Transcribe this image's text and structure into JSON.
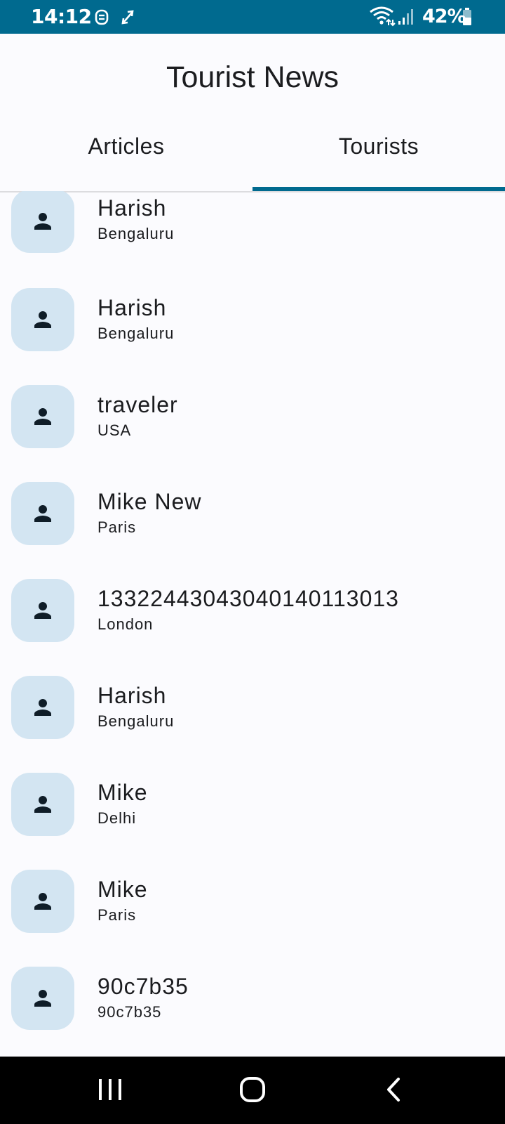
{
  "status_bar": {
    "time": "14:12",
    "battery": "42%",
    "icons": [
      "app-notification-icon",
      "sync-icon",
      "wifi-icon",
      "signal-icon",
      "battery-icon"
    ],
    "background_color": "#006a8f"
  },
  "app": {
    "title": "Tourist News"
  },
  "tabs": [
    {
      "label": "Articles",
      "selected": false
    },
    {
      "label": "Tourists",
      "selected": true
    }
  ],
  "accent_color": "#006a8f",
  "tourists": [
    {
      "name": "Harish",
      "city": "Bengaluru"
    },
    {
      "name": "Harish",
      "city": "Bengaluru"
    },
    {
      "name": "traveler",
      "city": "USA"
    },
    {
      "name": "Mike New",
      "city": "Paris"
    },
    {
      "name": "13322443043040140113013",
      "city": "London"
    },
    {
      "name": "Harish",
      "city": "Bengaluru"
    },
    {
      "name": "Mike",
      "city": "Delhi"
    },
    {
      "name": "Mike",
      "city": "Paris"
    },
    {
      "name": "90c7b35",
      "city": "90c7b35"
    }
  ],
  "nav_bar": {
    "buttons": [
      "recent-apps-icon",
      "home-icon",
      "back-icon"
    ]
  }
}
